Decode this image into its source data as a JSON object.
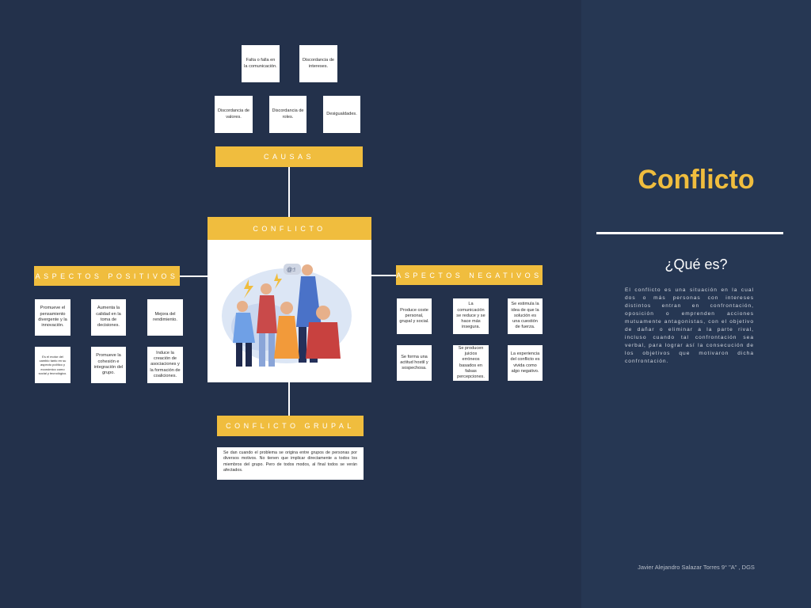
{
  "title": "Conflicto",
  "question": "¿Qué es?",
  "definition": "El conflicto es una situación en la cual dos o más personas con intereses distintos entran en confrontación, oposición o emprenden acciones mutuamente antagonistas, con el objetivo de dañar o eliminar a la parte rival, incluso cuando tal confrontación sea verbal, para lograr así la consecución de los objetivos que motivaron dicha confrontación.",
  "author": "Javier Alejandro Salazar Torres 9° \"A\" , DGS",
  "center": {
    "label": "CONFLICTO"
  },
  "causas": {
    "label": "CAUSAS",
    "items": [
      "Falta o falla en la comunicación.",
      "Discordancia de intereses.",
      "Discordancia de valores.",
      "Discordancia de roles.",
      "Desigualdades."
    ]
  },
  "positivos": {
    "label": "ASPECTOS POSITIVOS",
    "items": [
      "Promueve el pensamiento divergente y la innovación.",
      "Aumenta la calidad en la toma de decisiones.",
      "Mejora del rendimiento.",
      "Es el motor del cambio tanto en su aspecto político y económico como social y tecnológico.",
      "Promueve la cohesión e integración del grupo.",
      "Induce la creación de asociaciones y la formación de coaliciones."
    ]
  },
  "negativos": {
    "label": "ASPECTOS NEGATIVOS",
    "items": [
      "Produce coste personal, grupal y social.",
      "La comunicación se reduce y se hace más insegura.",
      "Se estimula la idea de que la solución es una cuestión de fuerza.",
      "Se forma una actitud hostil y sospechosa.",
      "Se producen juicios erróneos basados en falsas percepciones.",
      "La experiencia del conflicto es vivida como algo negativo."
    ]
  },
  "grupal": {
    "label": "CONFLICTO GRUPAL",
    "description": "Se dan cuando el problema se origina entre grupos de personas por diversos motivos. No tienen que implicar directamente a todos los miembros del grupo. Pero de todos modos, al final todos se verán afectados."
  },
  "colors": {
    "background": "#23314b",
    "sidebar": "#263753",
    "accent": "#f0bd3e"
  },
  "illustration": {
    "icon": "people-arguing-illustration",
    "bubble": "@:!"
  }
}
